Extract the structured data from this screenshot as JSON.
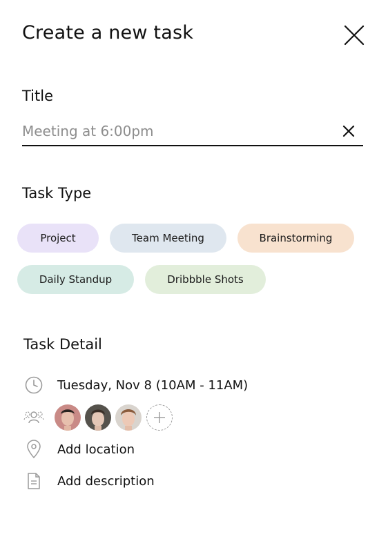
{
  "header": {
    "title": "Create a new task"
  },
  "title_field": {
    "label": "Title",
    "placeholder": "Meeting at 6:00pm"
  },
  "task_type": {
    "label": "Task Type",
    "chips": [
      {
        "label": "Project",
        "color": "#e9e2f8"
      },
      {
        "label": "Team Meeting",
        "color": "#dfe7ef"
      },
      {
        "label": "Brainstorming",
        "color": "#f8e2cf"
      },
      {
        "label": "Daily Standup",
        "color": "#d6ebe5"
      },
      {
        "label": "Dribbble Shots",
        "color": "#e2eedb"
      }
    ]
  },
  "task_detail": {
    "label": "Task Detail",
    "datetime": "Tuesday, Nov 8 (10AM - 11AM)",
    "location": "Add location",
    "description": "Add description"
  },
  "icons": [
    "close-icon",
    "clear-icon",
    "clock-icon",
    "people-icon",
    "location-pin-icon",
    "document-icon",
    "plus-icon"
  ]
}
